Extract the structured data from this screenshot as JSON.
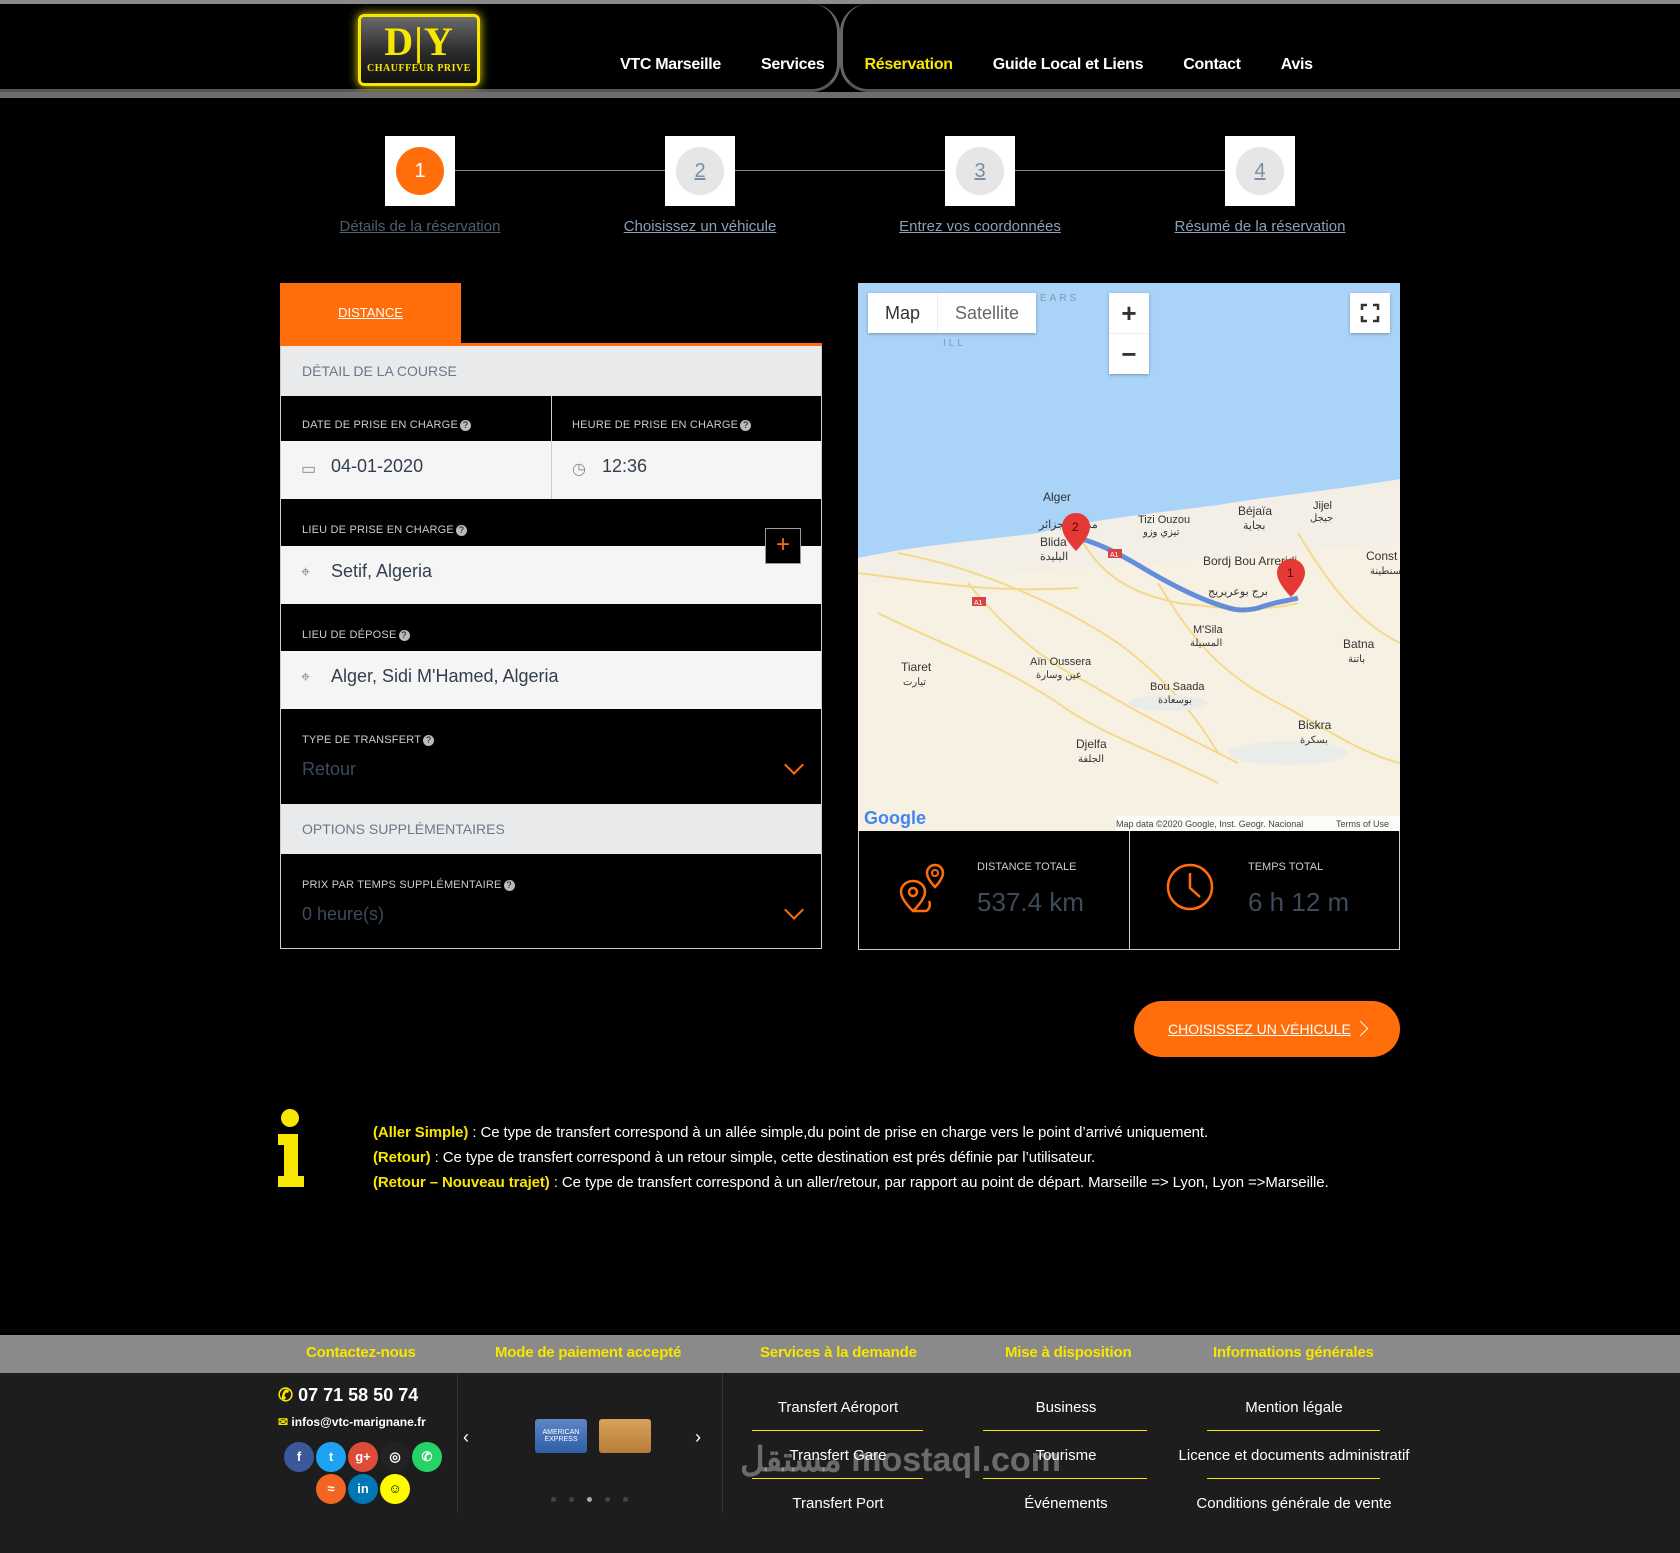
{
  "nav": {
    "logo_big": "D|Y",
    "logo_small": "CHAUFFEUR PRIVE",
    "items": [
      "VTC Marseille",
      "Services",
      "Réservation",
      "Guide Local et Liens",
      "Contact",
      "Avis"
    ],
    "active": "Réservation"
  },
  "steps": [
    {
      "num": "1",
      "label": "Détails de la réservation"
    },
    {
      "num": "2",
      "label": "Choisissez un véhicule"
    },
    {
      "num": "3",
      "label": "Entrez vos coordonnées"
    },
    {
      "num": "4",
      "label": "Résumé de la réservation"
    }
  ],
  "form": {
    "tab": "DISTANCE",
    "section_detail": "DÉTAIL DE LA COURSE",
    "date_label": "DATE DE PRISE EN CHARGE",
    "date_value": "04-01-2020",
    "time_label": "HEURE DE PRISE EN CHARGE",
    "time_value": "12:36",
    "pickup_label": "LIEU DE PRISE EN CHARGE",
    "pickup_value": "Setif, Algeria",
    "dropoff_label": "LIEU DE DÉPOSE",
    "dropoff_value": "Alger, Sidi M'Hamed, Algeria",
    "transfer_label": "TYPE DE TRANSFERT",
    "transfer_value": "Retour",
    "section_options": "OPTIONS SUPPLÉMENTAIRES",
    "extra_label": "PRIX PAR TEMPS SUPPLÉMENTAIRE",
    "extra_value": "0 heure(s)"
  },
  "map": {
    "btn_map": "Map",
    "btn_satellite": "Satellite",
    "zoom_in": "+",
    "zoom_out": "−",
    "attribution": "Map data ©2020 Google, Inst. Geogr. Nacional",
    "terms": "Terms of Use",
    "google": "Google",
    "cities": [
      "Alger",
      "مدينة الجزائر",
      "Blida",
      "البليدة",
      "Tizi Ouzou",
      "تيزي وزو",
      "Béjaïa",
      "بجاية",
      "Jijel",
      "جيجل",
      "Const",
      "قسنطينة",
      "Bordj Bou Arreridj",
      "برج بوعريريج",
      "M'Sila",
      "المسيلة",
      "Batna",
      "باتنة",
      "Tiaret",
      "تيارت",
      "Aïn Oussera",
      "عين وسارة",
      "Bou Saada",
      "بوسعادة",
      "Biskra",
      "بسكرة",
      "Djelfa",
      "الجلفة",
      "EARS",
      "ILL"
    ],
    "markers": [
      "1",
      "2"
    ],
    "road": "A1"
  },
  "stats": {
    "distance_label": "DISTANCE TOTALE",
    "distance_value": "537.4 km",
    "time_label": "TEMPS TOTAL",
    "time_value": "6 h 12 m"
  },
  "cta": "CHOISISSEZ UN VÉHICULE",
  "info": [
    {
      "title": "(Aller Simple)",
      "text": " : Ce type de transfert correspond à un allée simple,du point de prise en charge vers le point d’arrivé uniquement."
    },
    {
      "title": "(Retour)",
      "text": " : Ce type de transfert correspond à un retour simple, cette destination est prés définie par l’utilisateur."
    },
    {
      "title": "(Retour – Nouveau trajet)",
      "text": " : Ce type de transfert correspond à un aller/retour,  par rapport au point de départ. Marseille => Lyon, Lyon =>Marseille."
    }
  ],
  "footer": {
    "headings": [
      "Contactez-nous",
      "Mode de paiement accepté",
      "Services à la demande",
      "Mise à disposition",
      "Informations générales"
    ],
    "phone": "07 71 58 50 74",
    "email": "infos@vtc-marignane.fr",
    "services": [
      "Transfert Aéroport",
      "Transfert Gare",
      "Transfert Port"
    ],
    "dispo": [
      "Business",
      "Tourisme",
      "Événements"
    ],
    "infos": [
      "Mention légale",
      "Licence et documents administratif",
      "Conditions générale de vente"
    ],
    "card_amex": "AMERICAN EXPRESS",
    "watermark": "مستقل mostaql.com"
  },
  "colors": {
    "accent": "#ff6e0a",
    "yellow": "#f7e600",
    "header_gray": "#8a8a8a"
  }
}
